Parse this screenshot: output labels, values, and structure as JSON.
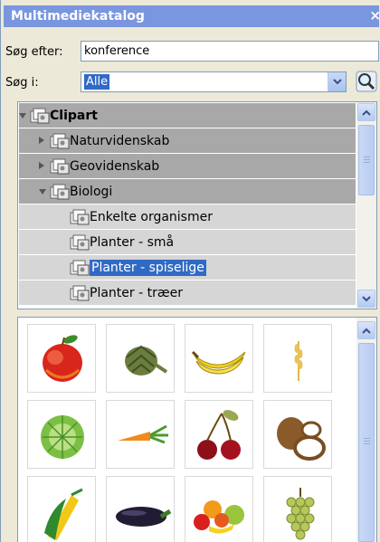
{
  "panel": {
    "title": "Multimediekatalog",
    "close_glyph": "×"
  },
  "search": {
    "label": "Søg efter:",
    "value": "konference"
  },
  "scope": {
    "label": "Søg i:",
    "selected": "Alle"
  },
  "tree": {
    "items": [
      {
        "label": "Clipart",
        "expander": "expanded",
        "selected": false,
        "bold": true
      },
      {
        "label": "Naturvidenskab",
        "expander": "collapsed",
        "selected": false,
        "bold": false
      },
      {
        "label": "Geovidenskab",
        "expander": "collapsed",
        "selected": false,
        "bold": false
      },
      {
        "label": "Biologi",
        "expander": "expanded",
        "selected": false,
        "bold": false
      },
      {
        "label": "Enkelte organismer",
        "expander": "none",
        "selected": false,
        "bold": false
      },
      {
        "label": "Planter - små",
        "expander": "none",
        "selected": false,
        "bold": false
      },
      {
        "label": "Planter - spiselige",
        "expander": "none",
        "selected": true,
        "bold": false
      },
      {
        "label": "Planter - træer",
        "expander": "none",
        "selected": false,
        "bold": false
      }
    ]
  },
  "gallery": {
    "items": [
      {
        "icon": "apple-icon"
      },
      {
        "icon": "artichoke-icon"
      },
      {
        "icon": "bananas-icon"
      },
      {
        "icon": "wheat-icon"
      },
      {
        "icon": "cabbage-icon"
      },
      {
        "icon": "carrot-icon"
      },
      {
        "icon": "cherries-icon"
      },
      {
        "icon": "coconut-icon"
      },
      {
        "icon": "corn-icon"
      },
      {
        "icon": "eggplant-icon"
      },
      {
        "icon": "fruit-mix-icon"
      },
      {
        "icon": "grapes-icon"
      }
    ]
  },
  "colors": {
    "title_bar": "#7a96df",
    "selection": "#316ac5",
    "tree_row": "#d6d6d6",
    "tree_row_dark": "#a8a8a8"
  }
}
